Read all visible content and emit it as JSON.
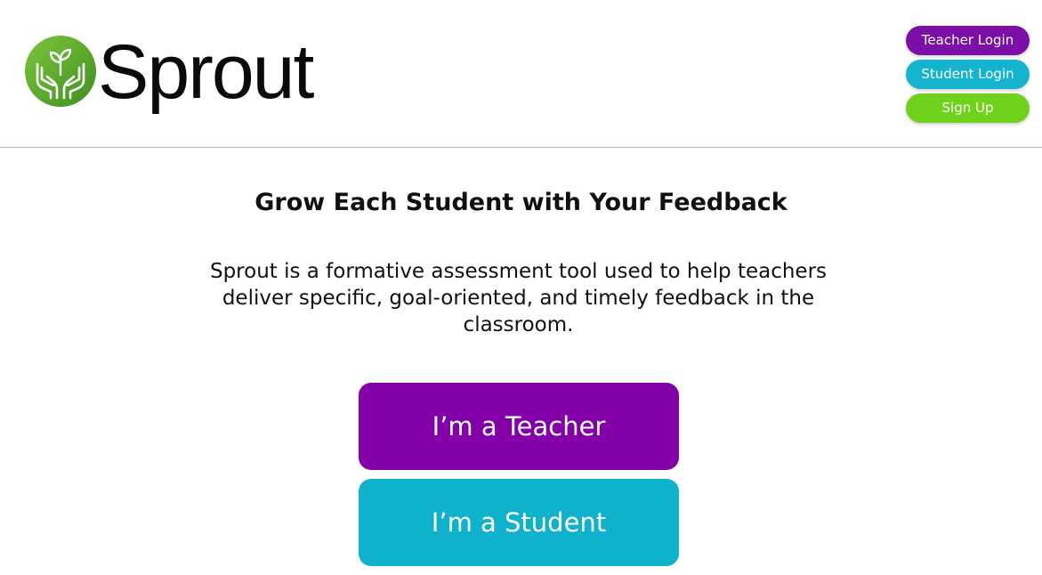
{
  "header": {
    "brand_name": "Sprout",
    "logo_icon": "hands-sprout-icon",
    "nav": {
      "teacher_login": "Teacher Login",
      "student_login": "Student Login",
      "sign_up": "Sign Up"
    }
  },
  "main": {
    "headline": "Grow Each Student with Your Feedback",
    "description": "Sprout is a formative assessment tool used to help teachers deliver specific, goal-oriented, and timely feedback in the classroom.",
    "teacher_cta": "I’m a Teacher",
    "student_cta": "I’m a Student"
  },
  "colors": {
    "purple": "#8400a8",
    "teal": "#0eb2cd",
    "green": "#6fd31c",
    "logo_green": "#5fb82a"
  }
}
